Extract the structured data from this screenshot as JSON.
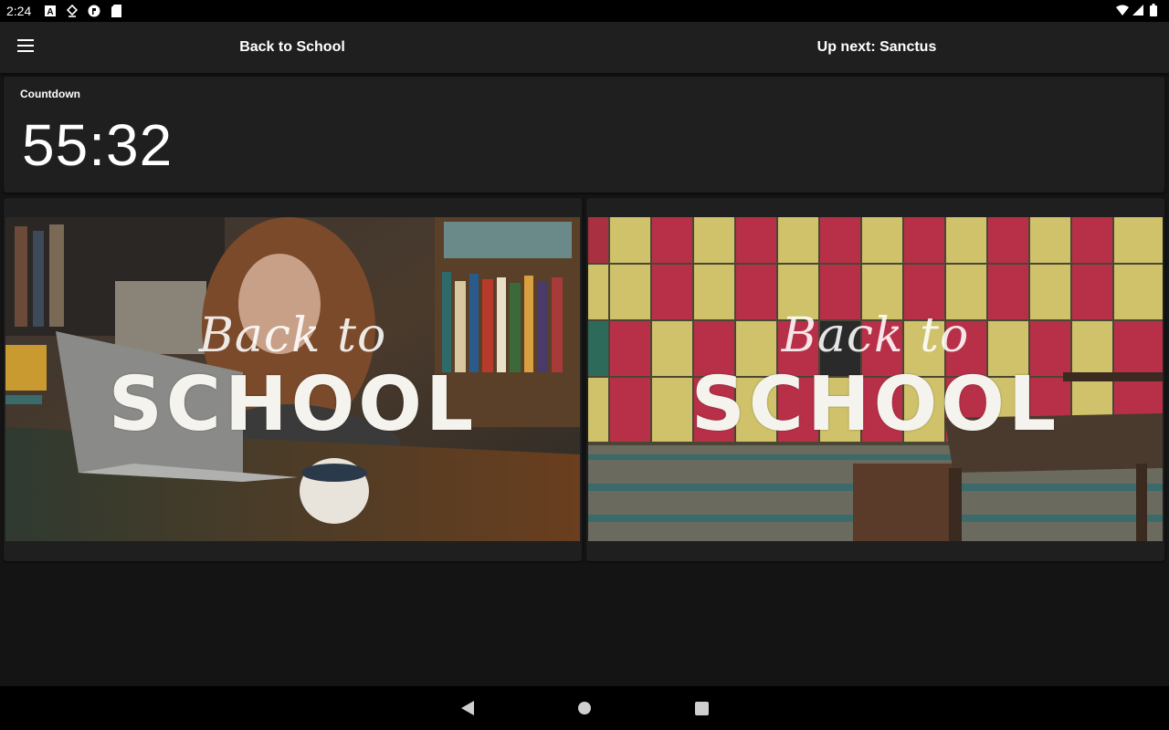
{
  "status_bar": {
    "time": "2:24",
    "left_icons": [
      "text-a-icon",
      "download-icon",
      "app-badge-icon",
      "sd-card-icon"
    ],
    "right_icons": [
      "wifi-icon",
      "signal-icon",
      "battery-icon"
    ]
  },
  "app_bar": {
    "menu_icon": "hamburger-menu-icon",
    "current_title": "Back to School",
    "next_title": "Up next: Sanctus"
  },
  "countdown": {
    "label": "Countdown",
    "time": "55:32"
  },
  "slides": {
    "current": {
      "script_text": "Back to",
      "main_text": "SCHOOL"
    },
    "next": {
      "script_text": "Back to",
      "main_text": "SCHOOL"
    }
  },
  "nav_bar": {
    "icons": [
      "back-triangle-icon",
      "home-circle-icon",
      "recents-square-icon"
    ]
  },
  "colors": {
    "background": "#141414",
    "surface": "#1f1f1f",
    "status_bar": "#000000",
    "text": "#ffffff"
  }
}
